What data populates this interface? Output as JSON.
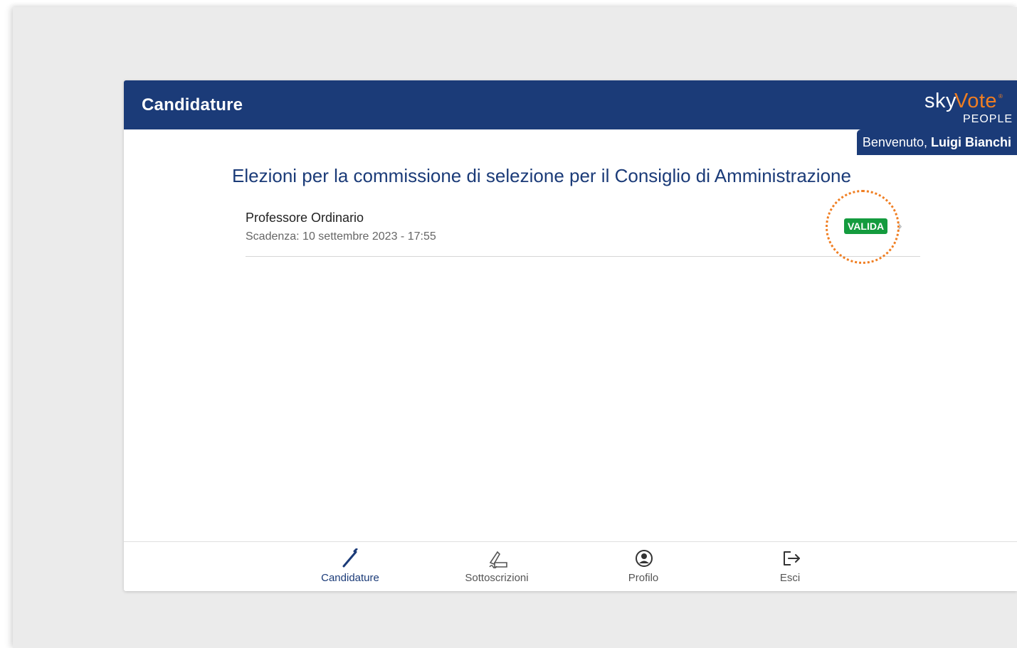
{
  "header": {
    "title": "Candidature",
    "logo": {
      "sky": "sky",
      "vote": "Vote",
      "reg": "®",
      "people": "PEOPLE"
    },
    "welcome_prefix": "Benvenuto,",
    "user_name": "Luigi Bianchi"
  },
  "main": {
    "election_title": "Elezioni per la commissione di selezione per il Consiglio di Amministrazione",
    "items": [
      {
        "title": "Professore Ordinario",
        "deadline": "Scadenza: 10 settembre 2023 - 17:55",
        "status": "VALIDA",
        "icon": "chevron-right-icon"
      }
    ]
  },
  "bottom_nav": [
    {
      "label": "Candidature",
      "icon": "pencil-icon",
      "active": true
    },
    {
      "label": "Sottoscrizioni",
      "icon": "signature-icon",
      "active": false
    },
    {
      "label": "Profilo",
      "icon": "user-circle-icon",
      "active": false
    },
    {
      "label": "Esci",
      "icon": "logout-icon",
      "active": false
    }
  ],
  "colors": {
    "brand_navy": "#1b3b78",
    "brand_orange": "#f07e22",
    "status_green": "#149b3e",
    "backdrop": "#ebebeb"
  }
}
